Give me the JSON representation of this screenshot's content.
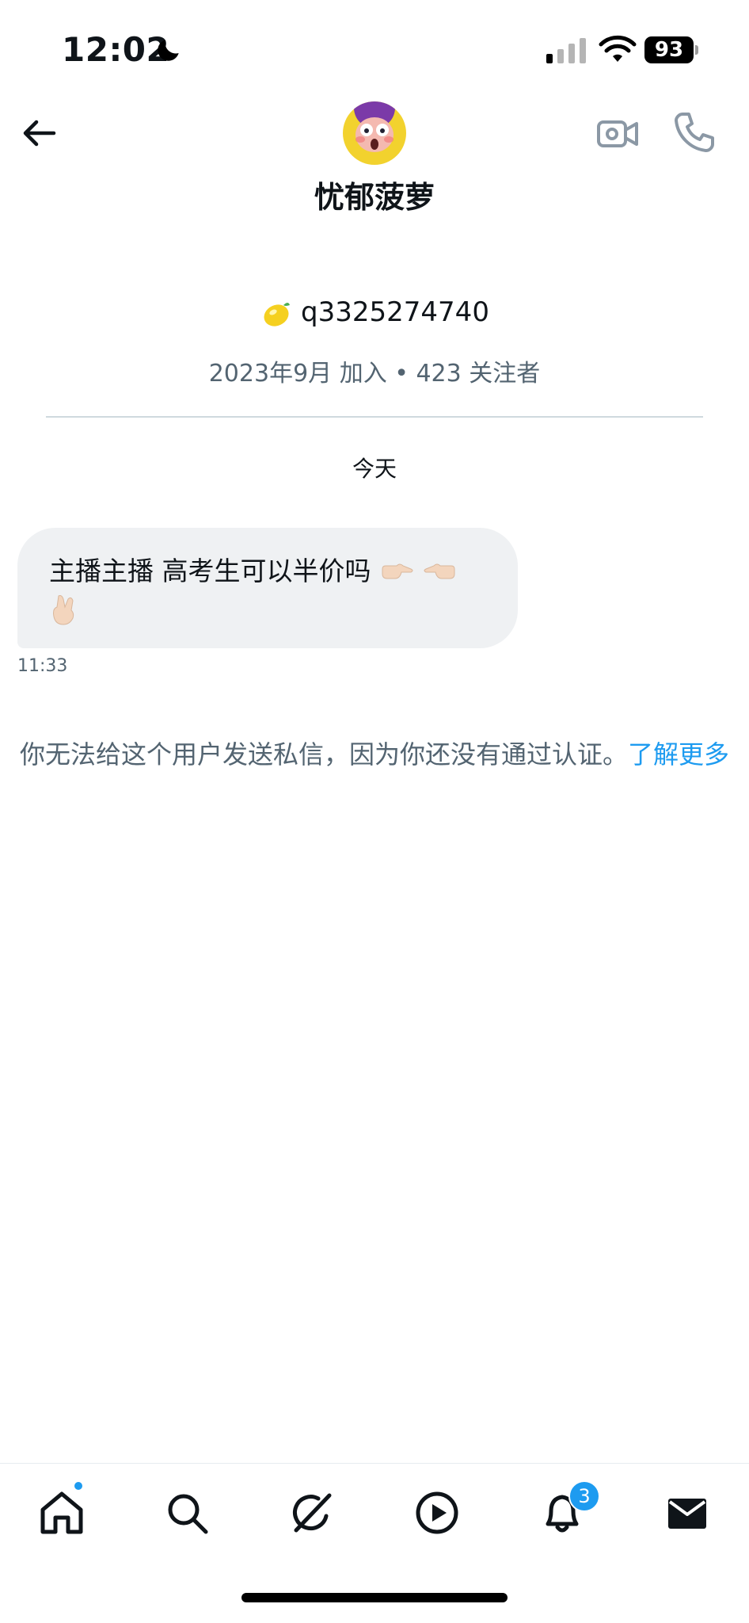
{
  "status_bar": {
    "time": "12:02",
    "battery": "93"
  },
  "header": {
    "contact_name": "忧郁菠萝"
  },
  "profile": {
    "handle": "q3325274740",
    "meta": "2023年9月 加入 • 423 关注者"
  },
  "conversation": {
    "date_separator": "今天",
    "messages": [
      {
        "text": "主播主播 高考生可以半价吗",
        "time": "11:33"
      }
    ]
  },
  "notice": {
    "text": "你无法给这个用户发送私信，因为你还没有通过认证。",
    "link_text": "了解更多"
  },
  "bottom_nav": {
    "items": [
      "home",
      "search",
      "grok",
      "video",
      "notifications",
      "messages"
    ],
    "notification_count": "3"
  },
  "colors": {
    "accent": "#1d9bf0",
    "secondary_text": "#536471",
    "bubble": "#eff1f3"
  }
}
